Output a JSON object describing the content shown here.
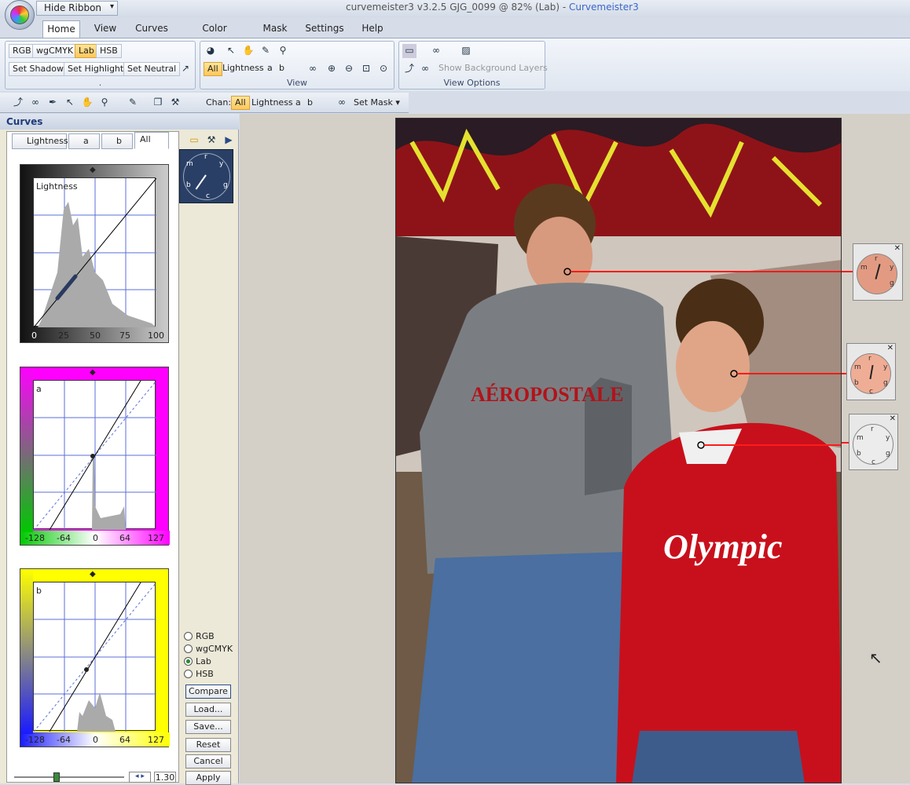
{
  "titlebar": {
    "hide_ribbon": "Hide Ribbon",
    "title": "curvemeister3 v3.2.5     GJG_0099 @ 82% (Lab)  -",
    "app_name": "Curvemeister3"
  },
  "ribbon_tabs": [
    "Home",
    "View",
    "Curves",
    "Color Sample",
    "Mask",
    "Settings",
    "Help"
  ],
  "mode_buttons": [
    "RGB",
    "wgCMYK",
    "Lab",
    "HSB"
  ],
  "set_buttons": [
    "Set Shadow",
    "Set Highlight",
    "Set Neutral"
  ],
  "view_group": {
    "label": "View",
    "chan_all": "All",
    "lightness": "Lightness",
    "a": "a",
    "b": "b"
  },
  "view_options": {
    "label": "View Options",
    "show_bg": "Show Background Layers"
  },
  "group1_dot": ".",
  "toolbar2": {
    "chan_label": "Chan:",
    "all": "All",
    "lightness": "Lightness",
    "a": "a",
    "b": "b",
    "set_mask": "Set Mask"
  },
  "panel": {
    "title": "Curves",
    "tabs": [
      "Lightness",
      "a",
      "b",
      "All"
    ],
    "lightness_label": "Lightness",
    "lightness_ticks": [
      "0",
      "25",
      "50",
      "75",
      "100"
    ],
    "a_label": "a",
    "ab_ticks": [
      "-128",
      "-64",
      "0",
      "64",
      "127"
    ],
    "b_label": "b"
  },
  "dial_letters": [
    "r",
    "y",
    "g",
    "c",
    "b",
    "m"
  ],
  "radios": [
    "RGB",
    "wgCMYK",
    "Lab",
    "HSB"
  ],
  "buttons": {
    "compare": "Compare",
    "load": "Load...",
    "save": "Save...",
    "reset": "Reset",
    "cancel": "Cancel",
    "apply": "Apply"
  },
  "slider_value": "1.30",
  "colors": {
    "accent": "#3a66c8",
    "selected": "#ffc75a",
    "a_channel": "#ff00ff",
    "b_channel": "#ffff00",
    "hoodie_red": "#c8101c",
    "hoodie_gray": "#7a7e82"
  }
}
